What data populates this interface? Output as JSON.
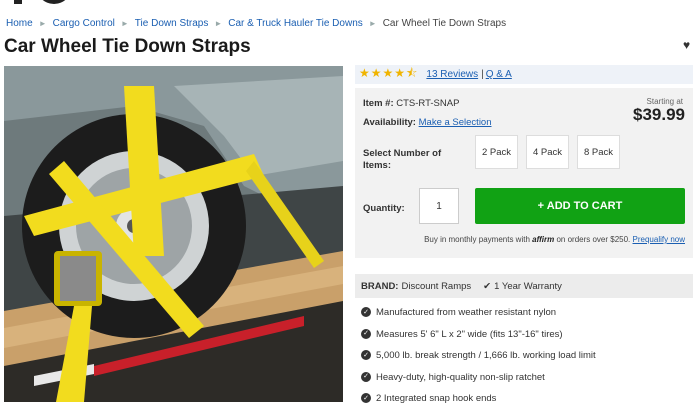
{
  "breadcrumbs": [
    {
      "label": "Home"
    },
    {
      "label": "Cargo Control"
    },
    {
      "label": "Tie Down Straps"
    },
    {
      "label": "Car & Truck Hauler Tie Downs"
    },
    {
      "label": "Car Wheel Tie Down Straps"
    }
  ],
  "product": {
    "title": "Car Wheel Tie Down Straps",
    "image_alt_icon": "product-photo",
    "rating_stars": "★★★★⯪",
    "rating_value_of_5": 4.5,
    "reviews_label": "13 Reviews",
    "qa_label": "Q & A",
    "item_label": "Item #:",
    "item_number": "CTS-RT-SNAP",
    "availability_label": "Availability:",
    "availability_value": "Make a Selection",
    "starting_at": "Starting at",
    "price": "$39.99",
    "select_label": "Select Number of Items:",
    "pack_options": [
      "2 Pack",
      "4 Pack",
      "8 Pack"
    ],
    "quantity_label": "Quantity:",
    "quantity_value": "1",
    "add_to_cart": "+ ADD TO CART",
    "affirm_prefix": "Buy in monthly payments with",
    "affirm_brand": "affirm",
    "affirm_suffix": "on orders over $250.",
    "prequalify": "Prequalify now",
    "brand_label": "BRAND:",
    "brand_value": "Discount Ramps",
    "warranty": "1 Year Warranty",
    "features": [
      "Manufactured from weather resistant nylon",
      "Measures 5' 6\" L x 2\" wide (fits 13\"-16\" tires)",
      "5,000 lb. break strength / 1,666 lb. working load limit",
      "Heavy-duty, high-quality non-slip ratchet",
      "2 Integrated snap hook ends"
    ]
  },
  "colors": {
    "link": "#1b5fb2",
    "cart_button": "#11a214",
    "stars": "#f0b400",
    "strap": "#f2dc1e"
  }
}
